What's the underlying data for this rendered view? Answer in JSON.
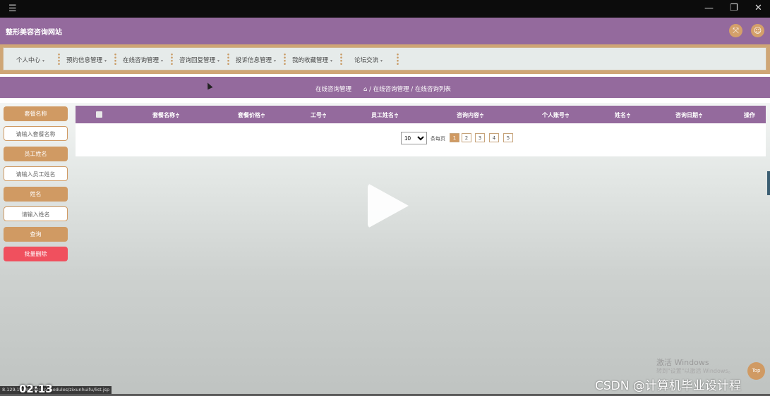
{
  "window": {
    "menu_icon": "hamburger-icon",
    "minimize": "—",
    "restore": "❐",
    "close": "✕"
  },
  "header": {
    "site_title": "整形美容咨询网站",
    "icon_left": "fullscreen-icon",
    "icon_right": "user-icon"
  },
  "nav": {
    "items": [
      {
        "label": "个人中心",
        "caret": "▾"
      },
      {
        "label": "预约信息管理",
        "caret": "▾"
      },
      {
        "label": "在线咨询管理",
        "caret": "▾"
      },
      {
        "label": "咨询回复管理",
        "caret": "▾"
      },
      {
        "label": "投诉信息管理",
        "caret": "▾"
      },
      {
        "label": "我的收藏管理",
        "caret": "▾"
      },
      {
        "label": "论坛交流",
        "caret": "▾"
      }
    ]
  },
  "breadcrumb": {
    "page_title": "在线咨询管理",
    "trail": "⌂ / 在线咨询管理 / 在线咨询列表"
  },
  "search": {
    "label_package": "套餐名称",
    "placeholder_package": "请输入套餐名称",
    "label_employee": "员工姓名",
    "placeholder_employee": "请输入员工姓名",
    "label_name": "姓名",
    "placeholder_name": "请输入姓名",
    "query_button": "查询",
    "batch_delete_button": "批量删除"
  },
  "table": {
    "columns": [
      "套餐名称≑",
      "套餐价格≑",
      "工号≑",
      "员工姓名≑",
      "咨询内容≑",
      "个人账号≑",
      "姓名≑",
      "咨询日期≑",
      "操作"
    ]
  },
  "pagination": {
    "page_size": "10",
    "page_size_label": "条每页",
    "pages": [
      "1",
      "2",
      "3",
      "4",
      "5"
    ],
    "active_page": "1"
  },
  "overlay": {
    "windows_activate_title": "激活 Windows",
    "windows_activate_sub": "转到\"设置\"以激活 Windows。",
    "top_button": "Top",
    "csdn_watermark": "CSDN @计算机毕业设计程",
    "url_status": "8.129.1  m89r3s/jsp/modules/zixunhuifu/list.jsp",
    "timer": "02:13"
  },
  "colors": {
    "primary_purple": "#946a9d",
    "accent_tan": "#d09a63",
    "danger": "#f0505e"
  }
}
